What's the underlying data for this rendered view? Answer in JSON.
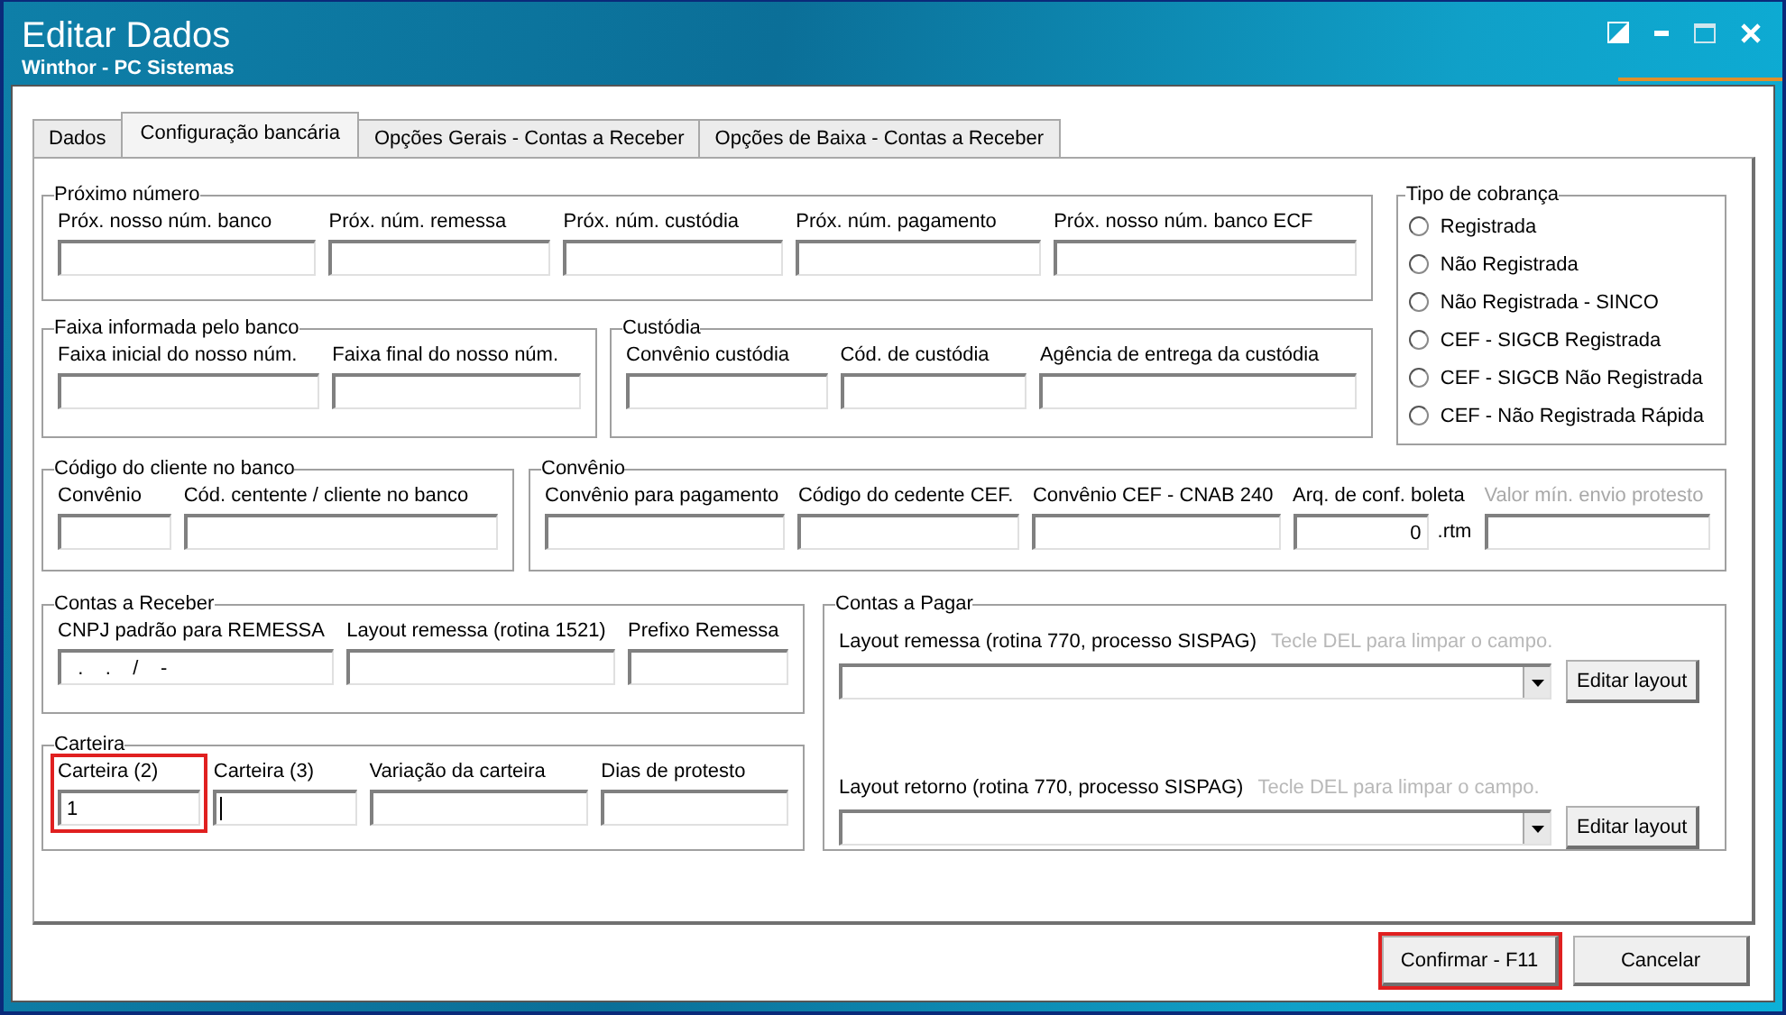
{
  "window": {
    "title": "Editar Dados",
    "subtitle": "Winthor - PC Sistemas"
  },
  "tabs": [
    {
      "label": "Dados",
      "selected": false
    },
    {
      "label": "Configuração bancária",
      "selected": true
    },
    {
      "label": "Opções Gerais - Contas a Receber",
      "selected": false
    },
    {
      "label": "Opções de Baixa - Contas a Receber",
      "selected": false
    }
  ],
  "groups": [
    {
      "title": "Próximo número",
      "kind": "fields",
      "fields": [
        {
          "label": "Próx. nosso núm. banco"
        },
        {
          "label": "Próx. núm. remessa"
        },
        {
          "label": "Próx. núm. custódia"
        },
        {
          "label": "Próx. núm. pagamento"
        },
        {
          "label": "Próx. nosso núm. banco ECF"
        }
      ]
    },
    {
      "title": "Faixa informada pelo banco",
      "kind": "fields",
      "fields": [
        {
          "label": "Faixa inicial do nosso núm."
        },
        {
          "label": "Faixa final do nosso núm."
        }
      ]
    },
    {
      "title": "Custódia",
      "kind": "fields",
      "fields": [
        {
          "label": "Convênio custódia"
        },
        {
          "label": "Cód. de custódia"
        },
        {
          "label": "Agência de entrega da custódia"
        }
      ]
    },
    {
      "title": "Tipo de cobrança",
      "kind": "radios",
      "options": [
        {
          "label": "Registrada",
          "selected": false
        },
        {
          "label": "Não Registrada",
          "selected": false
        },
        {
          "label": "Não Registrada - SINCO",
          "selected": false
        },
        {
          "label": "CEF - SIGCB Registrada",
          "selected": false
        },
        {
          "label": "CEF - SIGCB Não Registrada",
          "selected": false
        },
        {
          "label": "CEF - Não Registrada Rápida",
          "selected": false
        }
      ]
    },
    {
      "title": "Código do cliente no banco",
      "kind": "fields",
      "fields": [
        {
          "label": "Convênio"
        },
        {
          "label": "Cód. centente / cliente no banco"
        }
      ]
    },
    {
      "title": "Convênio",
      "kind": "fields",
      "fields": [
        {
          "label": "Convênio para pagamento",
          "disabled": false
        },
        {
          "label": "Código do cedente CEF.",
          "disabled": false
        },
        {
          "label": "Convênio CEF - CNAB 240",
          "disabled": false
        },
        {
          "label": "Arq. de conf. boleta",
          "kind": "number",
          "value": "0",
          "suffix": ".rtm",
          "disabled": false
        },
        {
          "label": "Valor mín. envio protesto",
          "disabled": true
        }
      ]
    },
    {
      "title": "Contas a Receber",
      "kind": "fields",
      "fields": [
        {
          "label": "CNPJ padrão para REMESSA",
          "value": "  .    .    /    -"
        },
        {
          "label": "Layout remessa (rotina 1521)"
        },
        {
          "label": "Prefixo Remessa"
        }
      ]
    },
    {
      "title": "Carteira",
      "kind": "fields",
      "fields": [
        {
          "label": "Carteira (2)",
          "value": "1",
          "focused": false,
          "highlighted": true
        },
        {
          "label": "Carteira (3)",
          "focused": true,
          "highlighted": false
        },
        {
          "label": "Variação da carteira",
          "focused": false,
          "highlighted": false
        },
        {
          "label": "Dias de protesto",
          "focused": false,
          "highlighted": false
        }
      ]
    },
    {
      "title": "Contas a Pagar",
      "kind": "layouts",
      "rows": [
        {
          "label": "Layout remessa (rotina 770, processo SISPAG)",
          "hint": "Tecle DEL para limpar o campo.",
          "button": "Editar layout"
        },
        {
          "label": "Layout retorno (rotina 770, processo SISPAG)",
          "hint": "Tecle DEL para limpar o campo.",
          "button": "Editar layout"
        }
      ]
    }
  ],
  "buttons": [
    {
      "label": "Confirmar - F11",
      "highlighted": true
    },
    {
      "label": "Cancelar",
      "highlighted": false
    }
  ]
}
